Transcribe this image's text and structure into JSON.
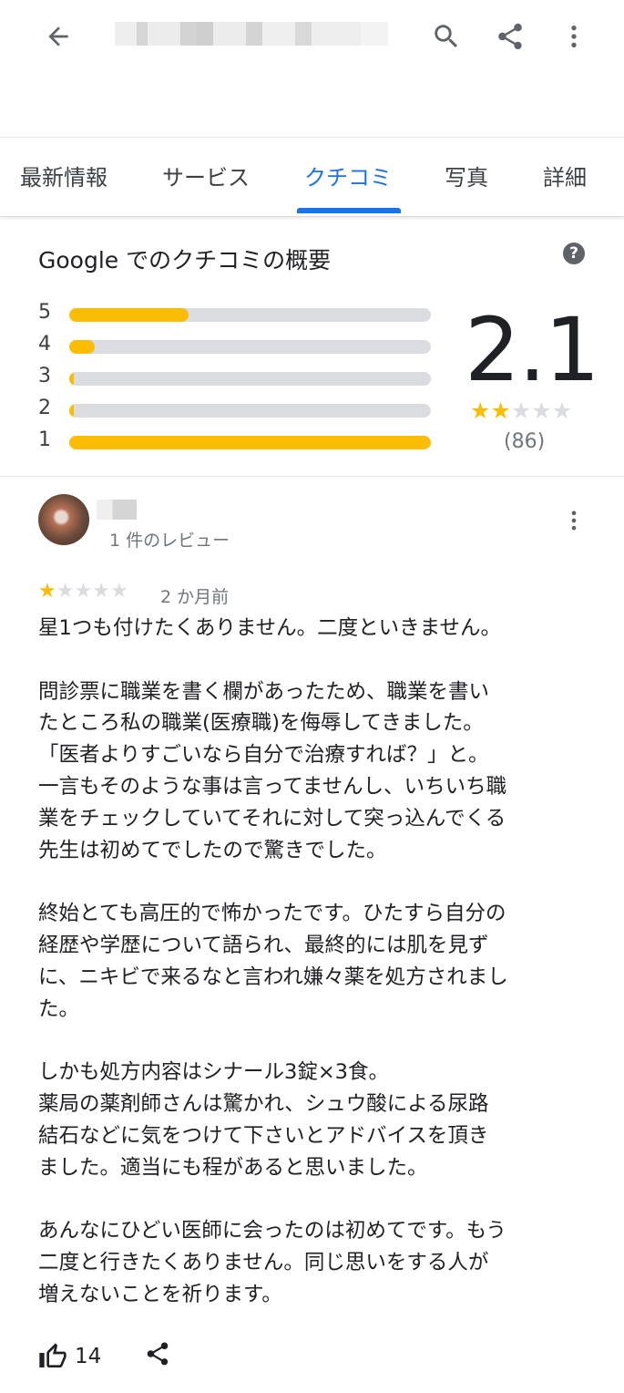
{
  "tabs": [
    {
      "label": "最新情報"
    },
    {
      "label": "サービス"
    },
    {
      "label": "クチコミ"
    },
    {
      "label": "写真"
    },
    {
      "label": "詳細"
    }
  ],
  "active_tab": "クチコミ",
  "overview": {
    "title": "Google でのクチコミの概要",
    "rating": "2.1",
    "rating_stars": 2,
    "review_count": "(86)",
    "distribution": [
      {
        "stars": "5",
        "fraction": 0.33
      },
      {
        "stars": "4",
        "fraction": 0.07
      },
      {
        "stars": "3",
        "fraction": 0.01
      },
      {
        "stars": "2",
        "fraction": 0.01
      },
      {
        "stars": "1",
        "fraction": 1.0
      }
    ]
  },
  "review": {
    "reviewer_review_count": "1 件のレビュー",
    "rating": 1,
    "date": "2 か月前",
    "text_lines": [
      "星1つも付けたくありません。二度といきません。",
      "",
      "問診票に職業を書く欄があったため、職業を書い",
      "たところ私の職業(医療職)を侮辱してきました。",
      "「医者よりすごいなら自分で治療すれば？」と。",
      "一言もそのような事は言ってませんし、いちいち職",
      "業をチェックしていてそれに対して突っ込んでくる",
      "先生は初めてでしたので驚きでした。",
      "",
      "終始とても高圧的で怖かったです。ひたすら自分の",
      "経歴や学歴について語られ、最終的には肌を見ず",
      "に、ニキビで来るなと言われ嫌々薬を処方されまし",
      "た。",
      "",
      "しかも処方内容はシナール3錠×3食。",
      "薬局の薬剤師さんは驚かれ、シュウ酸による尿路",
      "結石などに気をつけて下さいとアドバイスを頂き",
      "ました。適当にも程があると思いました。",
      "",
      "あんなにひどい医師に会ったのは初めてです。もう",
      "二度と行きたくありません。同じ思いをする人が",
      "増えないことを祈ります。"
    ],
    "like_count": "14"
  },
  "colors": {
    "accent": "#1a73e8",
    "star": "#fbbc04",
    "track": "#dadce0"
  }
}
